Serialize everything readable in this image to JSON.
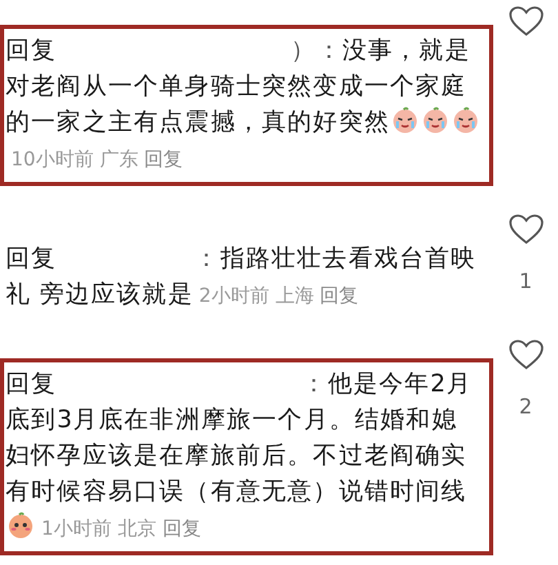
{
  "comments": [
    {
      "highlighted": true,
      "reply_label": "回复",
      "separator": "）：",
      "text": "没事，就是对老阎从一个单身骑士突然变成一个家庭的一家之主有点震撼，真的好突然",
      "emojis": [
        {
          "kind": "crying"
        },
        {
          "kind": "crying"
        },
        {
          "kind": "crying"
        }
      ],
      "time": "10小时前",
      "location": "广东",
      "reply_link": "回复"
    },
    {
      "highlighted": false,
      "reply_label": "回复",
      "separator": "：",
      "text": "指路壮壮去看戏台首映礼 旁边应该就是",
      "time": "2小时前",
      "location": "上海",
      "reply_link": "回复",
      "likes": "1"
    },
    {
      "highlighted": true,
      "reply_label": "回复",
      "separator": "：",
      "text": "他是今年2月底到3月底在非洲摩旅一个月。结婚和媳妇怀孕应该是在摩旅前后。不过老阎确实有时候容易口误（有意无意）说错时间线",
      "emojis": [
        {
          "kind": "blushing"
        }
      ],
      "time": "1小时前",
      "location": "北京",
      "reply_link": "回复",
      "likes": "2"
    }
  ]
}
